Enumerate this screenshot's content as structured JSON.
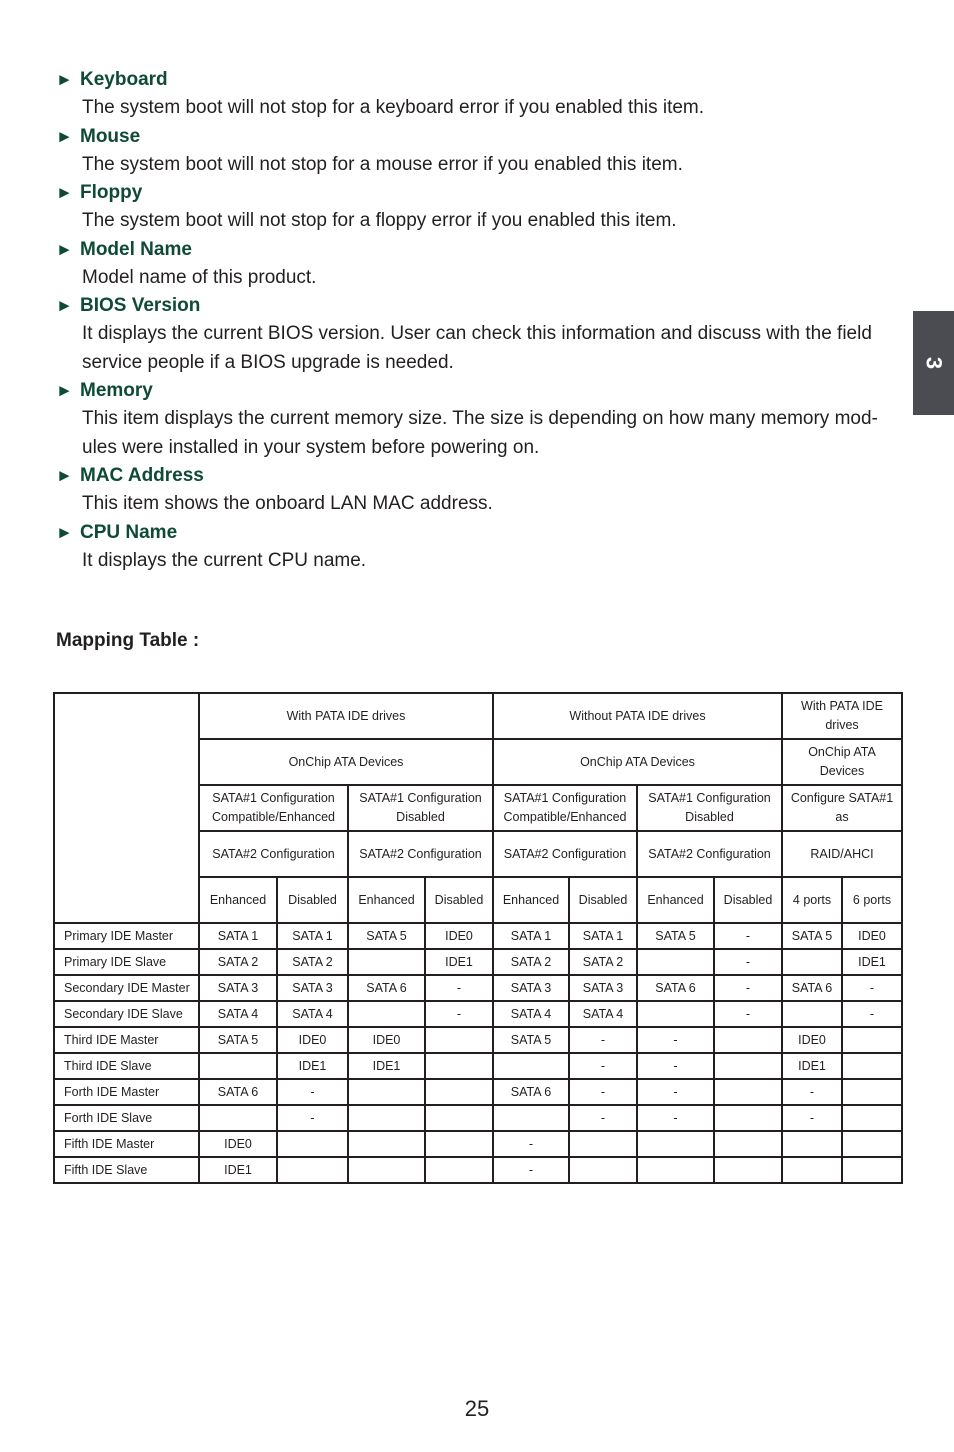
{
  "items": [
    {
      "title": "Keyboard",
      "desc": "The system boot will not stop for a keyboard error if you enabled this item."
    },
    {
      "title": "Mouse",
      "desc": "The system boot will not stop for a mouse error if you enabled this item."
    },
    {
      "title": "Floppy",
      "desc": "The system boot will not stop for a floppy error if you enabled this item."
    },
    {
      "title": "Model Name",
      "desc": "Model name of this product."
    },
    {
      "title": "BIOS Version",
      "desc": "It displays the current BIOS version. User can check this information and discuss with the field service people if a BIOS upgrade is needed."
    },
    {
      "title": "Memory",
      "desc": "This item displays the current memory size. The size is depending on how many memory mod-ules were installed in your system before powering on."
    },
    {
      "title": "MAC Address",
      "desc": "This item shows the onboard LAN MAC address."
    },
    {
      "title": "CPU Name",
      "desc": "It displays the current CPU name."
    }
  ],
  "arrow_glyph": "►",
  "side_tab": {
    "label": "3",
    "color": "#4a4c52"
  },
  "heading_color": "#0f4a35",
  "mapping": {
    "title": "Mapping Table :",
    "header": {
      "row1": [
        "With PATA IDE drives",
        "Without PATA IDE drives",
        "With PATA IDE drives"
      ],
      "row2": [
        "OnChip ATA Devices",
        "OnChip ATA Devices",
        "OnChip ATA Devices"
      ],
      "row3": [
        "SATA#1 Configuration Compatible/Enhanced",
        "SATA#1 Configuration Disabled",
        "SATA#1 Configuration Compatible/Enhanced",
        "SATA#1 Configuration Disabled",
        "Configure SATA#1 as"
      ],
      "row4": [
        "SATA#2 Configuration",
        "SATA#2 Configuration",
        "SATA#2 Configuration",
        "SATA#2 Configuration",
        "RAID/AHCI"
      ],
      "row5": [
        "Enhanced",
        "Disabled",
        "Enhanced",
        "Disabled",
        "Enhanced",
        "Disabled",
        "Enhanced",
        "Disabled",
        "4 ports",
        "6 ports"
      ]
    },
    "rows": [
      {
        "label": "Primary IDE Master",
        "cells": [
          "SATA 1",
          "SATA 1",
          "SATA 5",
          "IDE0",
          "SATA 1",
          "SATA 1",
          "SATA 5",
          "-",
          "SATA 5",
          "IDE0"
        ]
      },
      {
        "label": "Primary IDE Slave",
        "cells": [
          "SATA 2",
          "SATA 2",
          "",
          "IDE1",
          "SATA 2",
          "SATA 2",
          "",
          "-",
          "",
          "IDE1"
        ]
      },
      {
        "label": "Secondary IDE Master",
        "cells": [
          "SATA 3",
          "SATA 3",
          "SATA 6",
          "-",
          "SATA 3",
          "SATA 3",
          "SATA 6",
          "-",
          "SATA 6",
          "-"
        ]
      },
      {
        "label": "Secondary IDE Slave",
        "cells": [
          "SATA 4",
          "SATA 4",
          "",
          "-",
          "SATA 4",
          "SATA 4",
          "",
          "-",
          "",
          "-"
        ]
      },
      {
        "label": "Third IDE Master",
        "cells": [
          "SATA 5",
          "IDE0",
          "IDE0",
          "",
          "SATA 5",
          "-",
          "-",
          "",
          "IDE0",
          ""
        ]
      },
      {
        "label": "Third IDE Slave",
        "cells": [
          "",
          "IDE1",
          "IDE1",
          "",
          "",
          "-",
          "-",
          "",
          "IDE1",
          ""
        ]
      },
      {
        "label": "Forth IDE Master",
        "cells": [
          "SATA 6",
          "-",
          "",
          "",
          "SATA 6",
          "-",
          "-",
          "",
          "-",
          ""
        ]
      },
      {
        "label": "Forth IDE Slave",
        "cells": [
          "",
          "-",
          "",
          "",
          "",
          "-",
          "-",
          "",
          "-",
          ""
        ]
      },
      {
        "label": "Fifth IDE Master",
        "cells": [
          "IDE0",
          "",
          "",
          "",
          "-",
          "",
          "",
          "",
          "",
          ""
        ]
      },
      {
        "label": "Fifth IDE Slave",
        "cells": [
          "IDE1",
          "",
          "",
          "",
          "-",
          "",
          "",
          "",
          "",
          ""
        ]
      }
    ]
  },
  "page_number": "25"
}
